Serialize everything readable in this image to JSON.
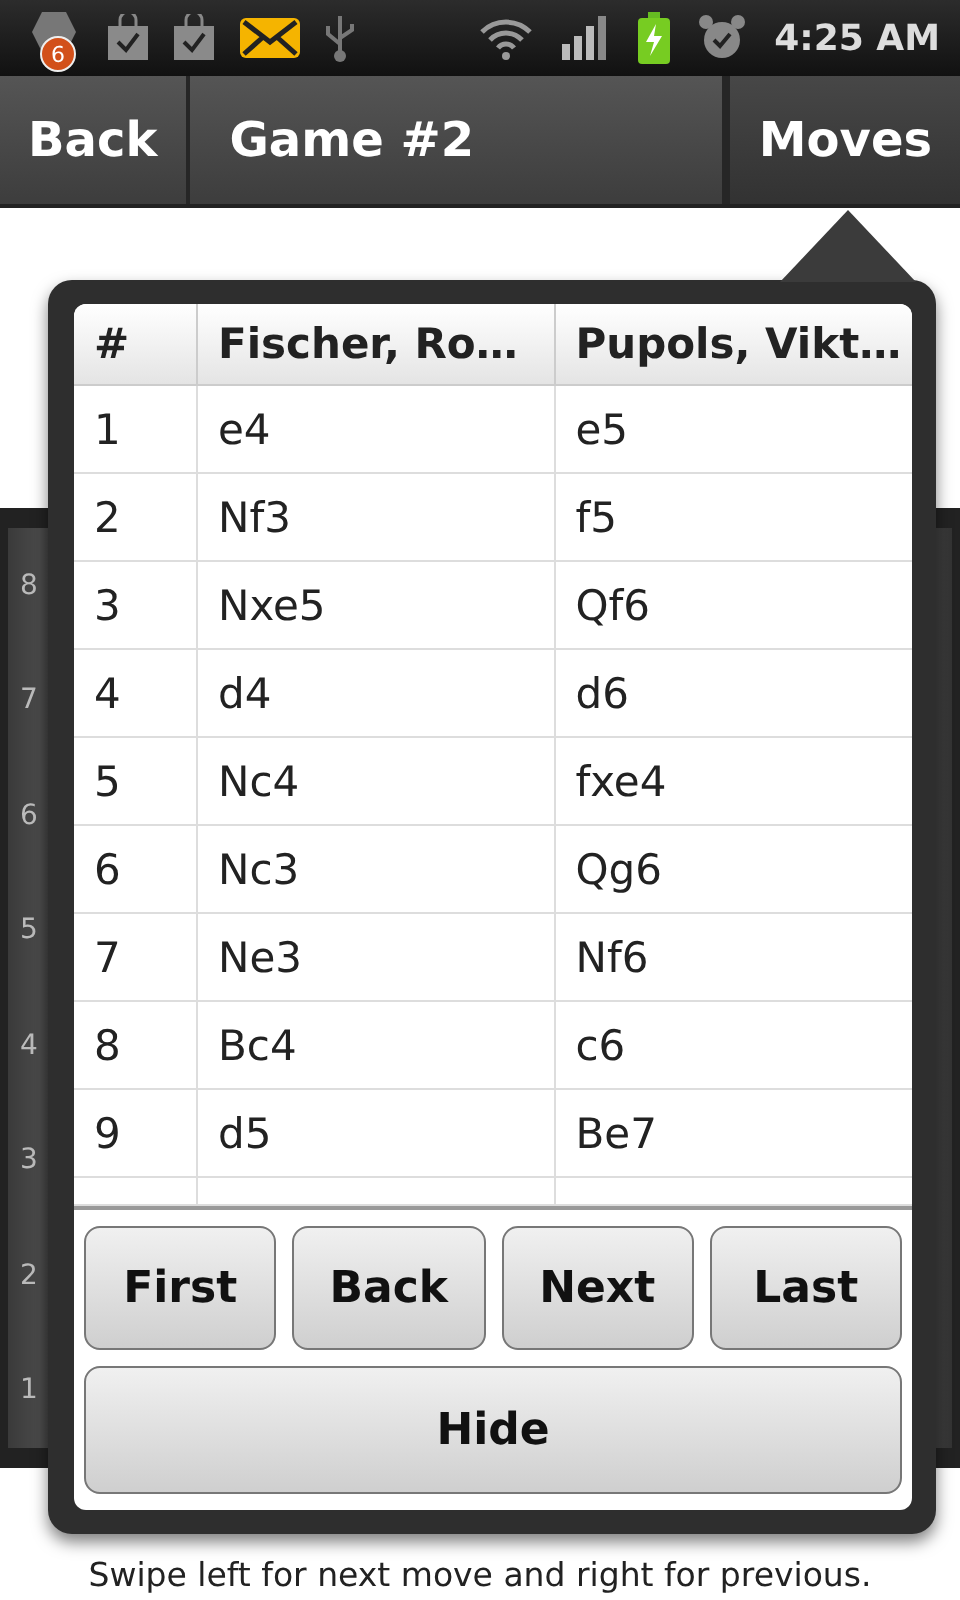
{
  "status_bar": {
    "notification_count": "6",
    "time": "4:25 AM"
  },
  "action_bar": {
    "back_button": "Back",
    "title": "Game #2",
    "moves_button": "Moves"
  },
  "board": {
    "ranks": [
      "8",
      "7",
      "6",
      "5",
      "4",
      "3",
      "2",
      "1"
    ]
  },
  "moves_table": {
    "columns": [
      "#",
      "Fischer, Ro…",
      "Pupols, Vikt…"
    ],
    "rows": [
      [
        "1",
        "e4",
        "e5"
      ],
      [
        "2",
        "Nf3",
        "f5"
      ],
      [
        "3",
        "Nxe5",
        "Qf6"
      ],
      [
        "4",
        "d4",
        "d6"
      ],
      [
        "5",
        "Nc4",
        "fxe4"
      ],
      [
        "6",
        "Nc3",
        "Qg6"
      ],
      [
        "7",
        "Ne3",
        "Nf6"
      ],
      [
        "8",
        "Bc4",
        "c6"
      ],
      [
        "9",
        "d5",
        "Be7"
      ]
    ]
  },
  "nav_buttons": [
    "First",
    "Back",
    "Next",
    "Last"
  ],
  "hide_button": "Hide",
  "hint": "Swipe left for next move and right for previous."
}
